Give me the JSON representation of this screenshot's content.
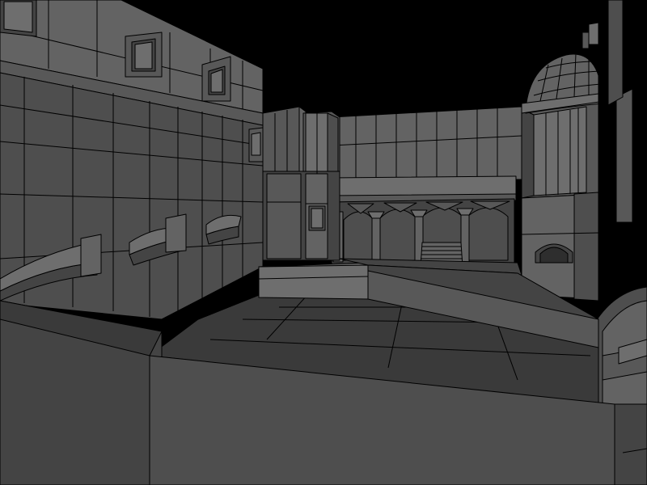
{
  "scene": {
    "kind": "3d-level-wireframe-render",
    "colors": {
      "sky": "#000000",
      "edge_lines": "#000000",
      "wall_light": "#636363",
      "wall_mid": "#585858",
      "wall_dark": "#444444",
      "floor": "#3a3a3a",
      "foreground_ledge": "#444444"
    },
    "objects": [
      "left-building-wall",
      "left-wall-windows",
      "curved-wall-niches",
      "center-tower-block",
      "back-arcade-wall",
      "arcade-arches",
      "arcade-stairs",
      "right-domed-tower",
      "dome",
      "right-archway",
      "courtyard-floor",
      "raised-platform",
      "ramp",
      "foreground-ledge"
    ]
  }
}
